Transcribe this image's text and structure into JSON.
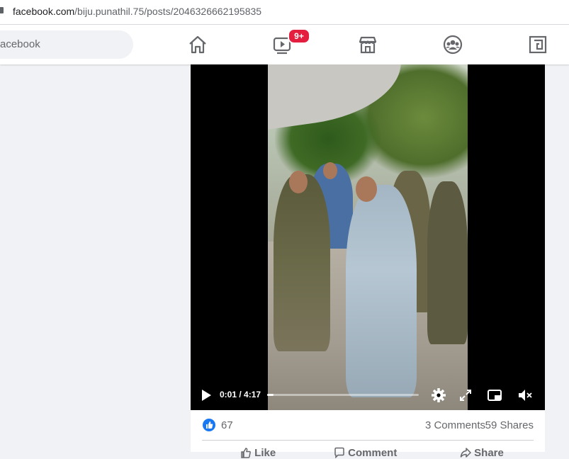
{
  "browser": {
    "url_domain": "facebook.com",
    "url_path": "/biju.punathil.75/posts/2046326662195835"
  },
  "header": {
    "search_text": "acebook",
    "watch_badge": "9+",
    "nav_icons": [
      "home-icon",
      "watch-icon",
      "marketplace-icon",
      "groups-icon",
      "gaming-icon"
    ]
  },
  "video": {
    "time": "0:01 / 4:17",
    "progress": 0.04
  },
  "post": {
    "likes": "67",
    "comments": "3 Comments",
    "shares": "59 Shares",
    "actions": [
      "Like",
      "Comment",
      "Share"
    ]
  },
  "colors": {
    "brand_blue": "#1877f2",
    "badge_red": "#e41e3f"
  }
}
